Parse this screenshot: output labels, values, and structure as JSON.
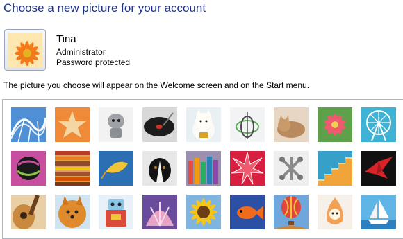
{
  "page": {
    "title": "Choose a new picture for your account",
    "hint": "The picture you choose will appear on the Welcome screen and on the Start menu."
  },
  "account": {
    "name": "Tina",
    "role": "Administrator",
    "password_status": "Password protected",
    "picture": "orange-flower"
  },
  "pictures": [
    {
      "name": "roller-coaster"
    },
    {
      "name": "starfish"
    },
    {
      "name": "robot-toy"
    },
    {
      "name": "turntable"
    },
    {
      "name": "lucky-cat"
    },
    {
      "name": "gyroscope"
    },
    {
      "name": "kitten"
    },
    {
      "name": "pink-flower"
    },
    {
      "name": "ferris-wheel"
    },
    {
      "name": "ball"
    },
    {
      "name": "textiles"
    },
    {
      "name": "leaf"
    },
    {
      "name": "dog"
    },
    {
      "name": "crayons"
    },
    {
      "name": "red-star-lantern"
    },
    {
      "name": "jacks"
    },
    {
      "name": "stairs"
    },
    {
      "name": "origami-crane"
    },
    {
      "name": "guitar"
    },
    {
      "name": "pomeranian"
    },
    {
      "name": "tin-robot"
    },
    {
      "name": "shell"
    },
    {
      "name": "sunflower"
    },
    {
      "name": "goldfish"
    },
    {
      "name": "hot-air-balloon"
    },
    {
      "name": "rubber-toy"
    },
    {
      "name": "sailboat"
    }
  ]
}
